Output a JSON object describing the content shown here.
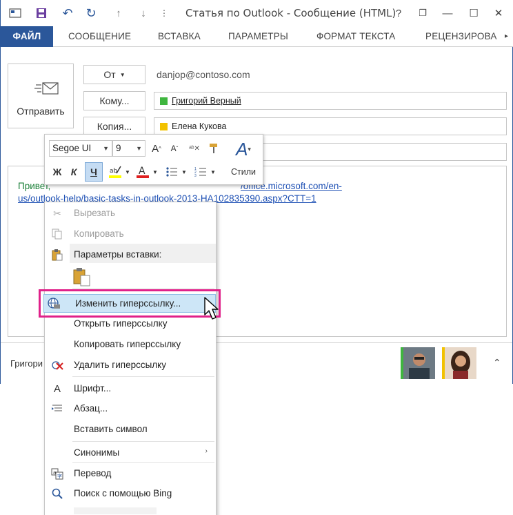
{
  "title": "Статья по Outlook - Сообщение (HTML)",
  "qat": {
    "icons": [
      "mail-icon",
      "save-icon",
      "undo-icon",
      "redo-icon",
      "up-arrow-icon",
      "down-arrow-icon",
      "customize-icon"
    ]
  },
  "window_controls": {
    "help": "?",
    "restore": "❐",
    "minimize": "—",
    "maximize": "☐",
    "close": "✕"
  },
  "tabs": [
    "ФАЙЛ",
    "СООБЩЕНИЕ",
    "ВСТАВКА",
    "ПАРАМЕТРЫ",
    "ФОРМАТ ТЕКСТА",
    "РЕЦЕНЗИРОВА"
  ],
  "send_label": "Отправить",
  "from": {
    "button": "От",
    "value": "danjop@contoso.com"
  },
  "to": {
    "button": "Кому...",
    "recipient": "Григорий Верный",
    "color": "#3fb63f"
  },
  "cc": {
    "button": "Копия...",
    "recipient": "Елена Кукова",
    "color": "#f2c200"
  },
  "body": {
    "prefix": "Привет,",
    "link_line1": "/office.microsoft.com/en-",
    "link_line2": "us/outlook-help/basic-tasks-in-outlook-2013-HA102835390.aspx?CTT=1"
  },
  "people_bar": {
    "name": "Григори"
  },
  "mini_toolbar": {
    "font": "Segoe UI",
    "size": "9",
    "grow": "A",
    "shrink": "A",
    "bold": "Ж",
    "italic": "К",
    "underline": "Ч",
    "styles": "Стили"
  },
  "context_menu": {
    "items": [
      {
        "label": "Вырезать",
        "icon": "scissors-icon",
        "disabled": true
      },
      {
        "label": "Копировать",
        "icon": "copy-icon",
        "disabled": true
      },
      {
        "label": "Параметры вставки:",
        "icon": "paste-options-icon",
        "disabled": false
      },
      {
        "label": "Изменить гиперссылку...",
        "icon": "edit-link-icon",
        "disabled": false,
        "highlighted": true
      },
      {
        "label": "Открыть гиперссылку",
        "icon": "",
        "disabled": false
      },
      {
        "label": "Копировать гиперссылку",
        "icon": "",
        "disabled": false
      },
      {
        "label": "Удалить гиперссылку",
        "icon": "remove-link-icon",
        "disabled": false
      },
      {
        "label": "Шрифт...",
        "icon": "font-icon",
        "disabled": false
      },
      {
        "label": "Абзац...",
        "icon": "paragraph-icon",
        "disabled": false
      },
      {
        "label": "Вставить символ",
        "icon": "",
        "disabled": false
      },
      {
        "label": "Синонимы",
        "icon": "",
        "disabled": false,
        "submenu": "›"
      },
      {
        "label": "Перевод",
        "icon": "translate-icon",
        "disabled": false
      },
      {
        "label": "Поиск с помощью Bing",
        "icon": "search-icon",
        "disabled": false
      }
    ]
  }
}
